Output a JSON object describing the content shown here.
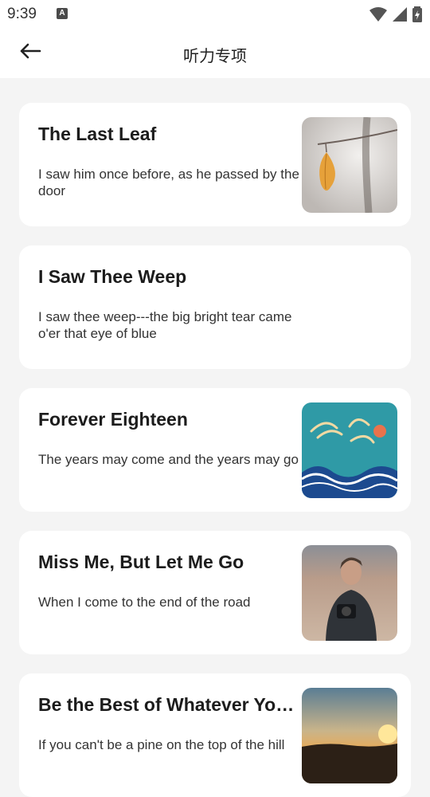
{
  "status": {
    "time": "9:39",
    "notification_letter": "A"
  },
  "header": {
    "title": "听力专项"
  },
  "items": [
    {
      "title": "The Last Leaf",
      "description": "I saw him once before, as he passed by the door",
      "image": "leaf-photo"
    },
    {
      "title": "I Saw Thee Weep",
      "description": "I saw thee weep---the big bright tear came o'er that eye of blue",
      "image": null
    },
    {
      "title": "Forever Eighteen",
      "description": "The years may come and the years may go",
      "image": "wave-poster-photo"
    },
    {
      "title": "Miss Me, But Let Me Go",
      "description": "When I come to the end of the road",
      "image": "portrait-photo"
    },
    {
      "title": "Be the Best of Whatever You Are",
      "description": "If you can't be a pine on the top of the hill",
      "image": "sunset-photo"
    }
  ],
  "colors": {
    "background": "#f4f4f4",
    "card": "#ffffff",
    "text": "#1a1a1a"
  }
}
